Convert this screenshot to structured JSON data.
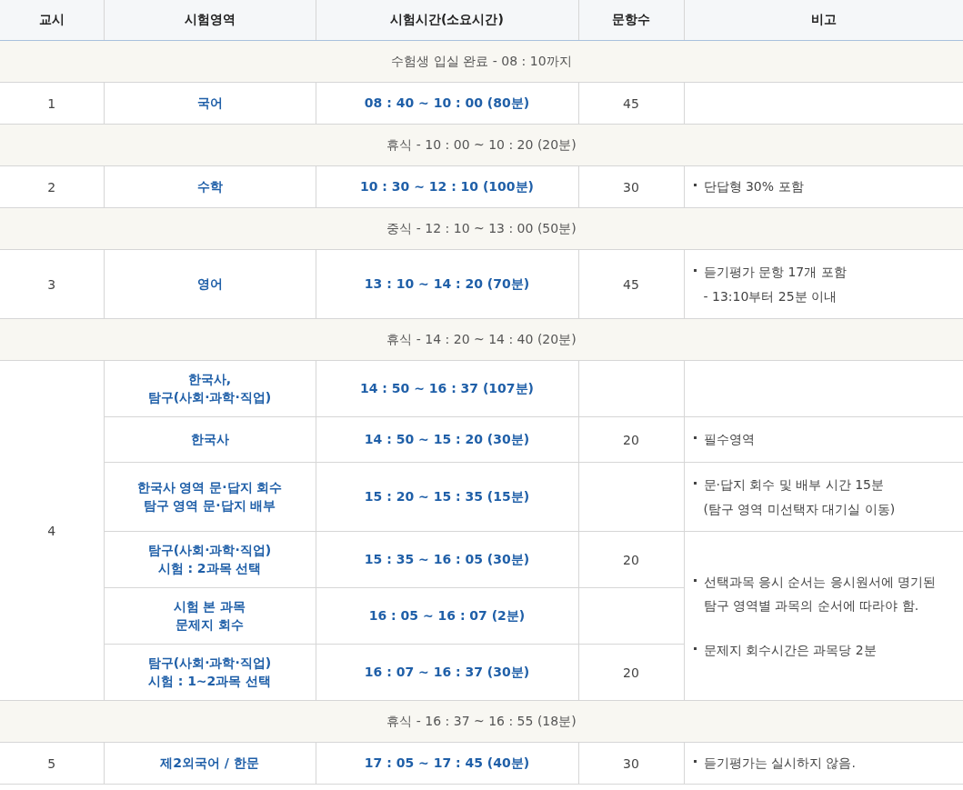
{
  "table": {
    "columns": [
      "교시",
      "시험영역",
      "시험시간(소요시간)",
      "문항수",
      "비고"
    ],
    "rows": [
      {
        "kind": "break",
        "text": "수험생 입실 완료 - 08 : 10까지"
      },
      {
        "kind": "session",
        "period": "1",
        "blocks": [
          {
            "parts": [
              {
                "subject": "국어",
                "time": "08 : 40 ~ 10 : 00 (80분)",
                "count": "45"
              }
            ]
          }
        ]
      },
      {
        "kind": "break",
        "text": "휴식 - 10 : 00 ~ 10 : 20 (20분)"
      },
      {
        "kind": "session",
        "period": "2",
        "blocks": [
          {
            "parts": [
              {
                "subject": "수학",
                "time": "10 : 30 ~ 12 : 10 (100분)",
                "count": "30"
              }
            ],
            "notes": [
              [
                "단답형 30% 포함"
              ]
            ]
          }
        ]
      },
      {
        "kind": "break",
        "text": "중식 - 12 : 10 ~ 13 : 00 (50분)"
      },
      {
        "kind": "session",
        "period": "3",
        "blocks": [
          {
            "parts": [
              {
                "subject": "영어",
                "time": "13 : 10 ~ 14 : 20 (70분)",
                "count": "45"
              }
            ],
            "notes": [
              [
                "듣기평가 문항 17개 포함",
                "- 13:10부터 25분 이내"
              ]
            ]
          }
        ]
      },
      {
        "kind": "break",
        "text": "휴식 - 14 : 20 ~ 14 : 40 (20분)"
      },
      {
        "kind": "session",
        "period": "4",
        "blocks": [
          {
            "parts": [
              {
                "subject": "한국사,\n탐구(사회·과학·직업)",
                "time": "14 : 50 ~ 16 : 37 (107분)"
              }
            ]
          },
          {
            "parts": [
              {
                "subject": "한국사",
                "time": "14 : 50 ~ 15 : 20 (30분)",
                "count": "20"
              }
            ],
            "notes": [
              [
                "필수영역"
              ]
            ]
          },
          {
            "parts": [
              {
                "subject": "한국사 영역 문·답지 회수\n탐구 영역 문·답지 배부",
                "time": "15 : 20 ~ 15 : 35 (15분)"
              }
            ],
            "notes": [
              [
                "문·답지 회수 및 배부 시간 15분",
                "(탐구 영역 미선택자 대기실 이동)"
              ]
            ]
          },
          {
            "parts": [
              {
                "subject": "탐구(사회·과학·직업)\n시험 : 2과목 선택",
                "time": "15 : 35 ~ 16 : 05 (30분)",
                "count": "20"
              },
              {
                "subject": "시험 본 과목\n문제지 회수",
                "time": "16 : 05 ~ 16 : 07 (2분)"
              },
              {
                "subject": "탐구(사회·과학·직업)\n시험 : 1~2과목 선택",
                "time": "16 : 07 ~ 16 : 37 (30분)",
                "count": "20"
              }
            ],
            "notes": [
              [
                "선택과목 응시 순서는 응시원서에 명기된",
                "탐구 영역별 과목의 순서에 따라야 함."
              ],
              [
                "문제지 회수시간은 과목당 2분"
              ]
            ]
          }
        ]
      },
      {
        "kind": "break",
        "text": "휴식 - 16 : 37 ~ 16 : 55 (18분)"
      },
      {
        "kind": "session",
        "period": "5",
        "blocks": [
          {
            "parts": [
              {
                "subject": "제2외국어 / 한문",
                "time": "17 : 05 ~ 17 : 45 (40분)",
                "count": "30"
              }
            ],
            "notes": [
              [
                "듣기평가는 실시하지 않음."
              ]
            ]
          }
        ]
      }
    ]
  }
}
